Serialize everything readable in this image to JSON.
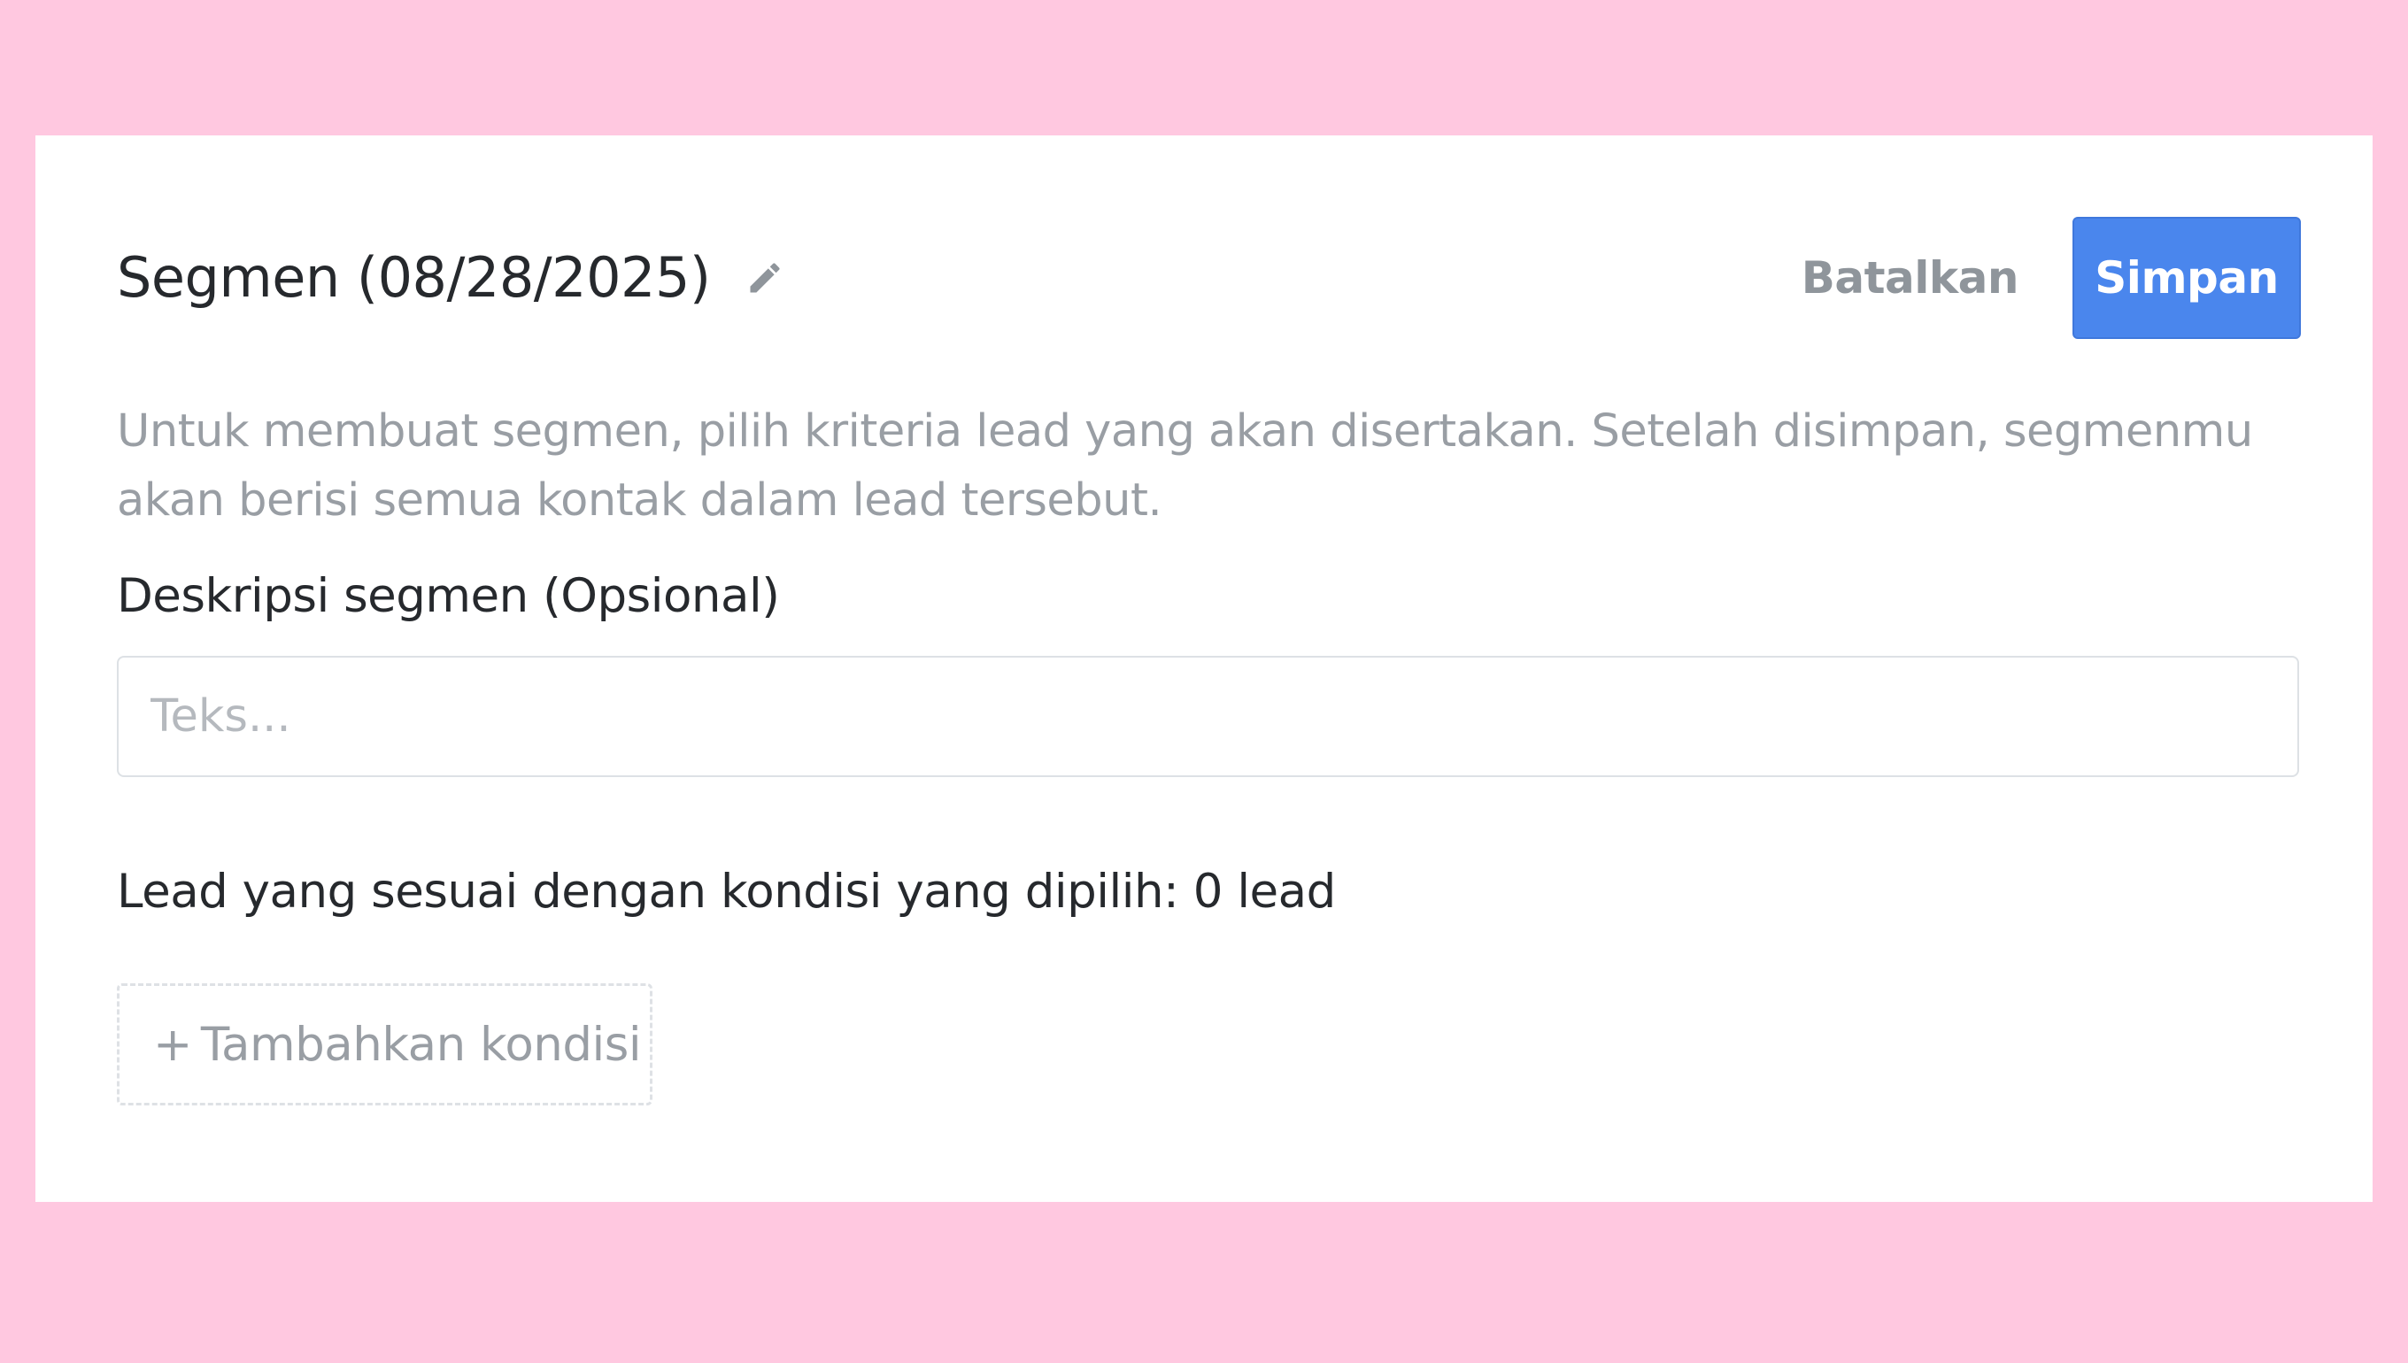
{
  "header": {
    "title": "Segmen (08/28/2025)",
    "edit_icon": "pencil-icon",
    "cancel_label": "Batalkan",
    "save_label": "Simpan"
  },
  "intro_text": "Untuk membuat segmen, pilih kriteria lead yang akan disertakan. Setelah disimpan, segmenmu akan berisi semua kontak dalam lead tersebut.",
  "description": {
    "label": "Deskripsi segmen (Opsional)",
    "placeholder": "Teks...",
    "value": ""
  },
  "match_text": "Lead yang sesuai dengan kondisi yang dipilih: 0 lead",
  "add_condition": {
    "icon": "plus",
    "label": "Tambahkan kondisi"
  },
  "colors": {
    "page_background": "#ffc8e0",
    "card_background": "#ffffff",
    "primary": "#4a86ed",
    "muted_text": "#999ea4",
    "dark_text": "#26292d"
  }
}
